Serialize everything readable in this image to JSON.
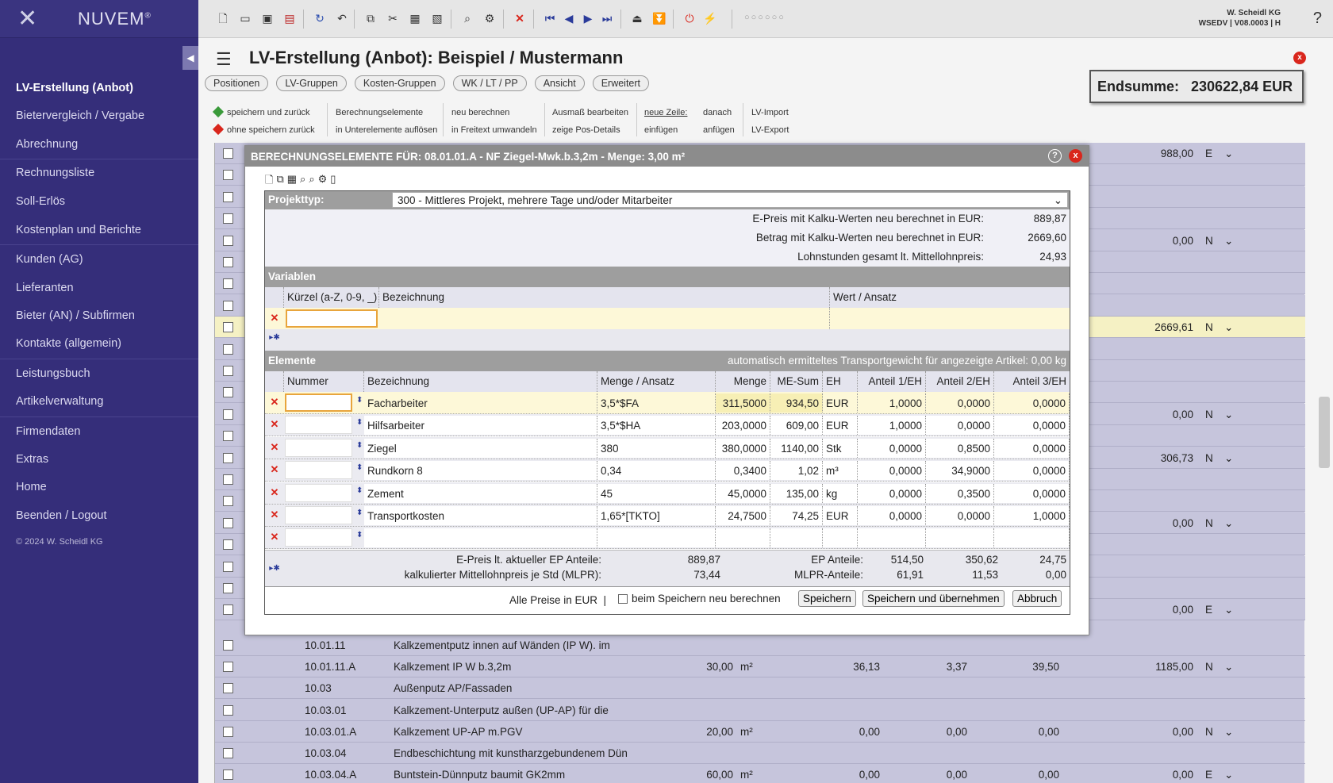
{
  "app": {
    "brand": "NUVEM",
    "brand_mark": "®",
    "company": "W. Scheidl KG",
    "version": "WSEDV | V08.0003 | H",
    "help": "?"
  },
  "sidebar": {
    "items": [
      "LV-Erstellung (Anbot)",
      "Bietervergleich / Vergabe",
      "Abrechnung",
      "Rechnungsliste",
      "Soll-Erlös",
      "Kostenplan und Berichte",
      "Kunden (AG)",
      "Lieferanten",
      "Bieter (AN) / Subfirmen",
      "Kontakte (allgemein)",
      "Leistungsbuch",
      "Artikelverwaltung",
      "Firmendaten",
      "Extras",
      "Home",
      "Beenden / Logout"
    ],
    "copyright": "© 2024 W. Scheidl KG"
  },
  "header": {
    "title": "LV-Erstellung (Anbot): Beispiel / Mustermann",
    "close": "x"
  },
  "tabs": [
    "Positionen",
    "LV-Gruppen",
    "Kosten-Gruppen",
    "WK / LT / PP",
    "Ansicht",
    "Erweitert"
  ],
  "total": {
    "label": "Endsumme:",
    "value": "230622,84 EUR"
  },
  "actions": {
    "save_back": "speichern und zurück",
    "nosave_back": "ohne speichern zurück",
    "calc_el": "Berechnungselemente",
    "calc_sub": "in Unterelemente auflösen",
    "recalc": "neu berechnen",
    "to_free": "in Freitext umwandeln",
    "meas": "Ausmaß bearbeiten",
    "pos_details": "zeige Pos-Details",
    "new_row": "neue Zeile:",
    "after": "danach",
    "insert": "einfügen",
    "append": "anfügen",
    "lv_import": "LV-Import",
    "lv_export": "LV-Export"
  },
  "dialog": {
    "title": "BERECHNUNGSELEMENTE FÜR: 08.01.01.A - NF Ziegel-Mwk.b.3,2m - Menge: 3,00 m²",
    "help": "?",
    "close": "x",
    "projekttyp_label": "Projekttyp:",
    "projekttyp_value": "300 - Mittleres Projekt, mehrere Tage und/oder Mitarbeiter",
    "summary": [
      {
        "label": "E-Preis mit Kalku-Werten neu berechnet in EUR:",
        "value": "889,87"
      },
      {
        "label": "Betrag  mit Kalku-Werten neu berechnet in EUR:",
        "value": "2669,60"
      },
      {
        "label": "Lohnstunden gesamt lt. Mittellohnpreis:",
        "value": "24,93"
      }
    ],
    "variablen": {
      "title": "Variablen",
      "cols": [
        "Kürzel (a-Z, 0-9, _)",
        "Bezeichnung",
        "Wert / Ansatz"
      ]
    },
    "elemente": {
      "title": "Elemente",
      "info": "automatisch ermitteltes Transportgewicht für angezeigte Artikel: 0,00 kg",
      "cols": [
        "Nummer",
        "Bezeichnung",
        "Menge / Ansatz",
        "Menge",
        "ME-Sum",
        "EH",
        "Anteil 1/EH",
        "Anteil 2/EH",
        "Anteil 3/EH"
      ],
      "rows": [
        [
          "Facharbeiter",
          "3,5*$FA",
          "311,5000",
          "934,50",
          "EUR",
          "1,0000",
          "0,0000",
          "0,0000"
        ],
        [
          "Hilfsarbeiter",
          "3,5*$HA",
          "203,0000",
          "609,00",
          "EUR",
          "1,0000",
          "0,0000",
          "0,0000"
        ],
        [
          "Ziegel",
          "380",
          "380,0000",
          "1140,00",
          "Stk",
          "0,0000",
          "0,8500",
          "0,0000"
        ],
        [
          "Rundkorn 8",
          "0,34",
          "0,3400",
          "1,02",
          "m³",
          "0,0000",
          "34,9000",
          "0,0000"
        ],
        [
          "Zement",
          "45",
          "45,0000",
          "135,00",
          "kg",
          "0,0000",
          "0,3500",
          "0,0000"
        ],
        [
          "Transportkosten",
          "1,65*[TKTO]",
          "24,7500",
          "74,25",
          "EUR",
          "0,0000",
          "0,0000",
          "1,0000"
        ],
        [
          "",
          "",
          "",
          "",
          "",
          "",
          "",
          ""
        ]
      ]
    },
    "footer": {
      "ep_label": "E-Preis lt. aktueller EP Anteile:",
      "ep_value": "889,87",
      "ep_ant_label": "EP Anteile:",
      "ep_ant": [
        "514,50",
        "350,62",
        "24,75"
      ],
      "mlpr_label": "kalkulierter Mittellohnpreis je Std (MLPR):",
      "mlpr_value": "73,44",
      "mlpr_ant_label": "MLPR-Anteile:",
      "mlpr_ant": [
        "61,91",
        "11,53",
        "0,00"
      ]
    },
    "bottom": {
      "note": "Alle Preise in EUR  |",
      "checkbox": "beim Speichern neu berechnen",
      "save": "Speichern",
      "save_apply": "Speichern und übernehmen",
      "cancel": "Abbruch"
    }
  },
  "background_rows": [
    {
      "pos": "10.01.11",
      "text": "Kalkzementputz innen auf Wänden (IP W). im"
    },
    {
      "pos": "10.01.11.A",
      "text": "Kalkzement IP W b.3,2m",
      "menge": "30,00",
      "eh": "m²",
      "v1": "36,13",
      "v2": "3,37",
      "v3": "39,50",
      "sum": "1185,00",
      "flag": "N"
    },
    {
      "pos": "10.03",
      "text": "Außenputz AP/Fassaden"
    },
    {
      "pos": "10.03.01",
      "text": "Kalkzement-Unterputz außen (UP-AP) für die"
    },
    {
      "pos": "10.03.01.A",
      "text": "Kalkzement UP-AP m.PGV",
      "menge": "20,00",
      "eh": "m²",
      "v1": "0,00",
      "v2": "0,00",
      "v3": "0,00",
      "sum": "0,00",
      "flag": "N"
    },
    {
      "pos": "10.03.04",
      "text": "Endbeschichtung mit kunstharzgebundenem Dün"
    },
    {
      "pos": "10.03.04.A",
      "text": "Buntstein-Dünnputz baumit GK2mm",
      "menge": "60,00",
      "eh": "m²",
      "v1": "0,00",
      "v2": "0,00",
      "v3": "0,00",
      "sum": "0,00",
      "flag": "E"
    }
  ],
  "background_right": [
    {
      "sum": "988,00",
      "flag": "E"
    },
    {
      "sum": "0,00",
      "flag": "N"
    },
    {
      "sum": "2669,61",
      "flag": "N"
    },
    {
      "sum": "0,00",
      "flag": "N"
    },
    {
      "sum": "306,73",
      "flag": "N"
    },
    {
      "sum": "0,00",
      "flag": "N"
    },
    {
      "sum": "0,00",
      "flag": "E"
    }
  ]
}
